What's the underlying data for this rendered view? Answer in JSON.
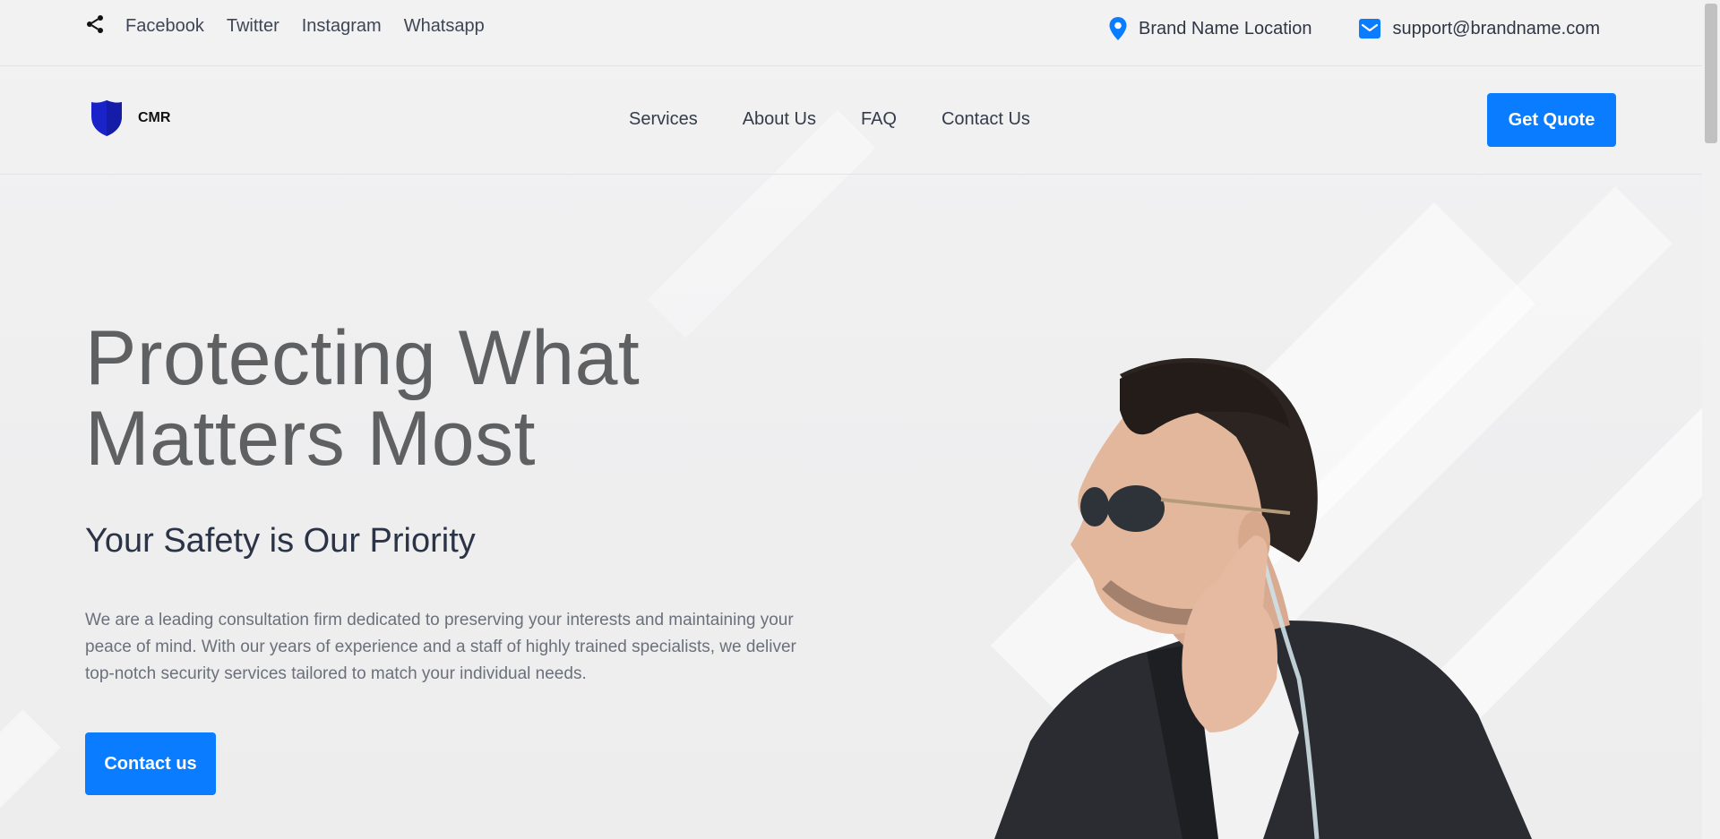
{
  "topbar": {
    "social_links": [
      "Facebook",
      "Twitter",
      "Instagram",
      "Whatsapp"
    ],
    "location": "Brand Name Location",
    "email": "support@brandname.com"
  },
  "navbar": {
    "brand": "CMR",
    "menu": [
      "Services",
      "About Us",
      "FAQ",
      "Contact Us"
    ],
    "cta": "Get Quote"
  },
  "hero": {
    "title_line1": "Protecting What",
    "title_line2": "Matters Most",
    "subtitle": "Your Safety is Our Priority",
    "description": "We are a leading consultation firm dedicated to preserving your interests and maintaining your peace of mind. With our years of experience and a staff of highly trained specialists, we deliver top-notch security services tailored to match your individual needs.",
    "button": "Contact us"
  },
  "colors": {
    "accent": "#0a7cff",
    "shield": "#1a23c8",
    "heading": "#5f6062",
    "subheading": "#2b3446"
  },
  "icons": {
    "share": "share-icon",
    "location": "location-pin-icon",
    "email": "mail-icon",
    "logo": "shield-icon"
  }
}
